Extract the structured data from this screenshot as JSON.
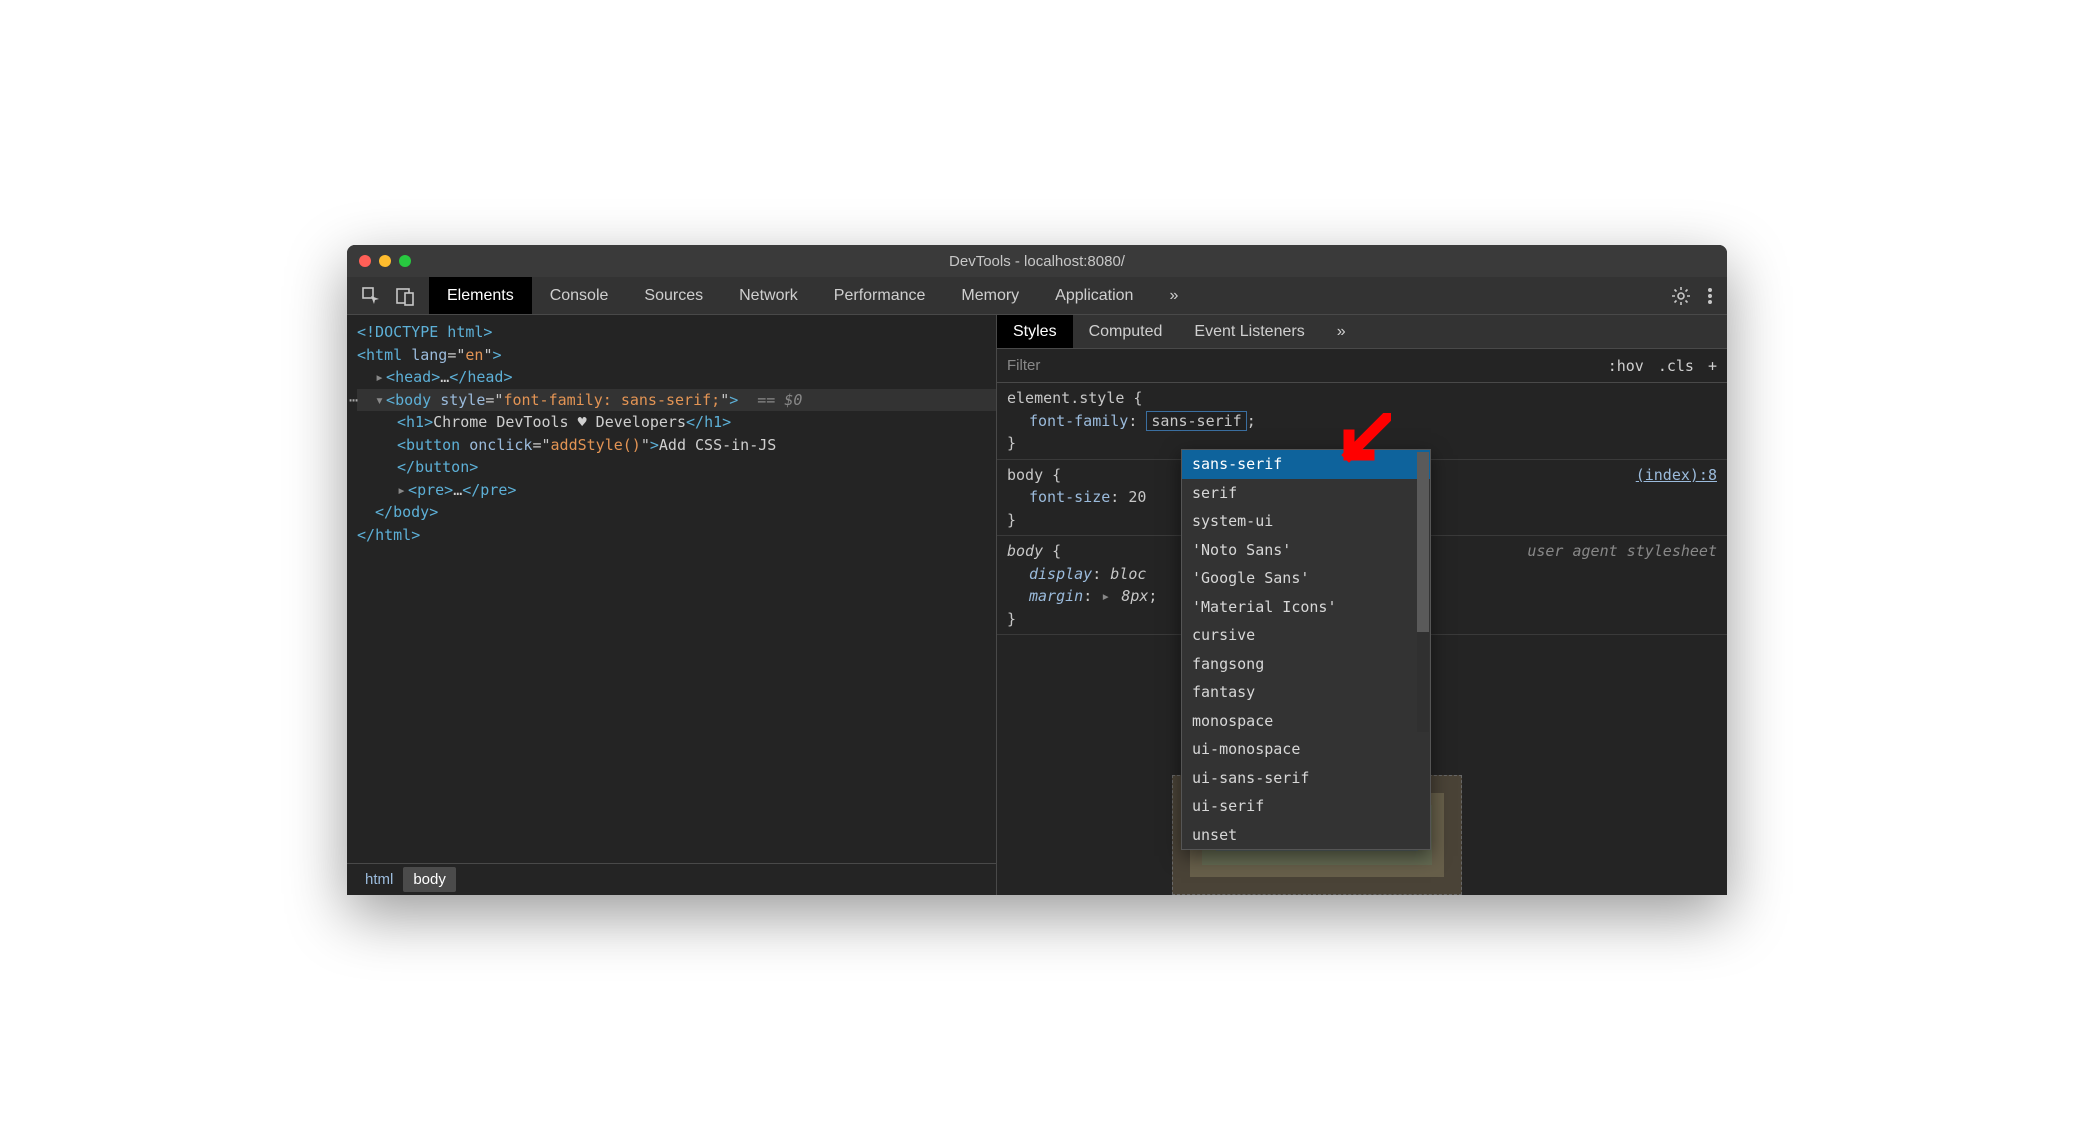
{
  "window": {
    "title": "DevTools - localhost:8080/"
  },
  "mainTabs": {
    "items": [
      "Elements",
      "Console",
      "Sources",
      "Network",
      "Performance",
      "Memory",
      "Application"
    ],
    "active": "Elements",
    "overflow": "»"
  },
  "domTree": {
    "doctype": "<!DOCTYPE html>",
    "htmlOpen": {
      "tag": "html",
      "attrName": "lang",
      "attrValue": "en"
    },
    "head": {
      "tag": "head",
      "ellipsis": "…"
    },
    "bodyOpen": {
      "tag": "body",
      "attrName": "style",
      "attrValue": "font-family: sans-serif;",
      "selectedSuffix": "== $0"
    },
    "h1": {
      "tag": "h1",
      "text": "Chrome DevTools ♥ Developers"
    },
    "button": {
      "tag": "button",
      "attrName": "onclick",
      "attrValue": "addStyle()",
      "text": "Add CSS-in-JS"
    },
    "pre": {
      "tag": "pre",
      "ellipsis": "…"
    },
    "bodyClose": "body",
    "htmlClose": "html"
  },
  "breadcrumb": {
    "items": [
      "html",
      "body"
    ],
    "active": "body"
  },
  "stylesTabs": {
    "items": [
      "Styles",
      "Computed",
      "Event Listeners"
    ],
    "active": "Styles",
    "overflow": "»"
  },
  "filter": {
    "placeholder": "Filter",
    "hov": ":hov",
    "cls": ".cls",
    "plus": "+"
  },
  "rules": {
    "elementStyle": {
      "selector": "element.style",
      "prop": "font-family",
      "val": "sans-serif"
    },
    "bodyRule": {
      "selector": "body",
      "prop": "font-size",
      "val": "20",
      "link": "(index):8"
    },
    "uaRule": {
      "selector": "body",
      "label": "user agent stylesheet",
      "props": [
        {
          "name": "display",
          "val": "bloc"
        },
        {
          "name": "margin",
          "val": "8px"
        }
      ]
    }
  },
  "autocomplete": {
    "items": [
      "sans-serif",
      "serif",
      "system-ui",
      "'Noto Sans'",
      "'Google Sans'",
      "'Material Icons'",
      "cursive",
      "fangsong",
      "fantasy",
      "monospace",
      "ui-monospace",
      "ui-sans-serif",
      "ui-serif",
      "unset"
    ],
    "selected": "sans-serif"
  },
  "punct": {
    "lt": "<",
    "gt": ">",
    "sl": "/",
    "eq": "=",
    "q": "\"",
    "ob": " {",
    "cb": "}",
    "colon": ": ",
    "semi": ";",
    "triCaret": "▸",
    "triDown": "▾"
  }
}
